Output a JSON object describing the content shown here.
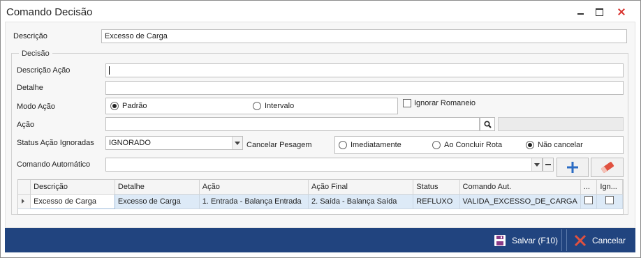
{
  "window": {
    "title": "Comando Decisão"
  },
  "form": {
    "descricao_label": "Descrição",
    "descricao_value": "Excesso de Carga",
    "group_title": "Decisão",
    "descricao_acao_label": "Descrição Ação",
    "descricao_acao_value": "",
    "detalhe_label": "Detalhe",
    "detalhe_value": "",
    "modo_acao_label": "Modo Ação",
    "modo_padrao": "Padrão",
    "modo_intervalo": "Intervalo",
    "ignorar_romaneio": "Ignorar Romaneio",
    "acao_label": "Ação",
    "acao_value": "",
    "status_label": "Status Ação Ignoradas",
    "status_value": "IGNORADO",
    "cancelar_label": "Cancelar Pesagem",
    "cancel_imediatamente": "Imediatamente",
    "cancel_ao_concluir": "Ao Concluir Rota",
    "cancel_nao": "Não cancelar",
    "comando_label": "Comando Automático",
    "comando_value": ""
  },
  "grid": {
    "headers": [
      "Descrição",
      "Detalhe",
      "Ação",
      "Ação Final",
      "Status",
      "Comando Aut.",
      "...",
      "Ign..."
    ],
    "rows": [
      [
        "Excesso de Carga",
        "Excesso de Carga",
        "1. Entrada - Balança Entrada",
        "2. Saída - Balança Saída",
        "REFLUXO",
        "VALIDA_EXCESSO_DE_CARGA"
      ]
    ]
  },
  "footer": {
    "save_label": "Salvar (F10)",
    "cancel_label": "Cancelar"
  },
  "colors": {
    "footer_bg": "#21447f",
    "selection_row": "#ddeaf7",
    "close_red": "#d8312c",
    "add_blue": "#2b6cc4",
    "eraser_red": "#e0513f"
  },
  "icons": {
    "search": "search-icon",
    "add": "plus-icon",
    "clear": "eraser-icon",
    "save": "floppy-disk-icon",
    "cancel": "close-x-icon"
  }
}
